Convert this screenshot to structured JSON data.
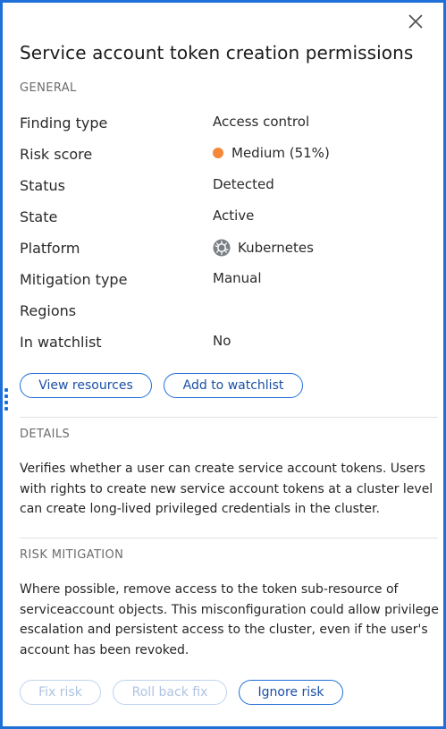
{
  "panel": {
    "title": "Service account token creation permissions"
  },
  "general": {
    "section_label": "GENERAL",
    "rows": [
      {
        "label": "Finding type",
        "value": "Access control"
      },
      {
        "label": "Risk score",
        "value": "Medium (51%)"
      },
      {
        "label": "Status",
        "value": "Detected"
      },
      {
        "label": "State",
        "value": "Active"
      },
      {
        "label": "Platform",
        "value": "Kubernetes"
      },
      {
        "label": "Mitigation type",
        "value": "Manual"
      },
      {
        "label": "Regions",
        "value": ""
      },
      {
        "label": "In watchlist",
        "value": "No"
      }
    ],
    "risk_color": "#f5883a",
    "buttons": {
      "view_resources": "View resources",
      "add_to_watchlist": "Add to watchlist"
    }
  },
  "details": {
    "section_label": "DETAILS",
    "text": "Verifies whether a user can create service account tokens. Users with rights to create new service account tokens at a cluster level can create long-lived privileged credentials in the cluster."
  },
  "risk_mitigation": {
    "section_label": "RISK MITIGATION",
    "text": "Where possible, remove access to the token sub-resource of serviceaccount objects. This misconfiguration could allow privilege escalation and persistent access to the cluster, even if the user's account has been revoked.",
    "buttons": {
      "fix_risk": "Fix risk",
      "roll_back_fix": "Roll back fix",
      "ignore_risk": "Ignore risk"
    }
  },
  "colors": {
    "accent": "#1f6fd8",
    "border": "#1f6fd8"
  },
  "icons": {
    "close": "close-icon",
    "platform": "kubernetes-icon",
    "grip": "drag-handle-icon"
  }
}
